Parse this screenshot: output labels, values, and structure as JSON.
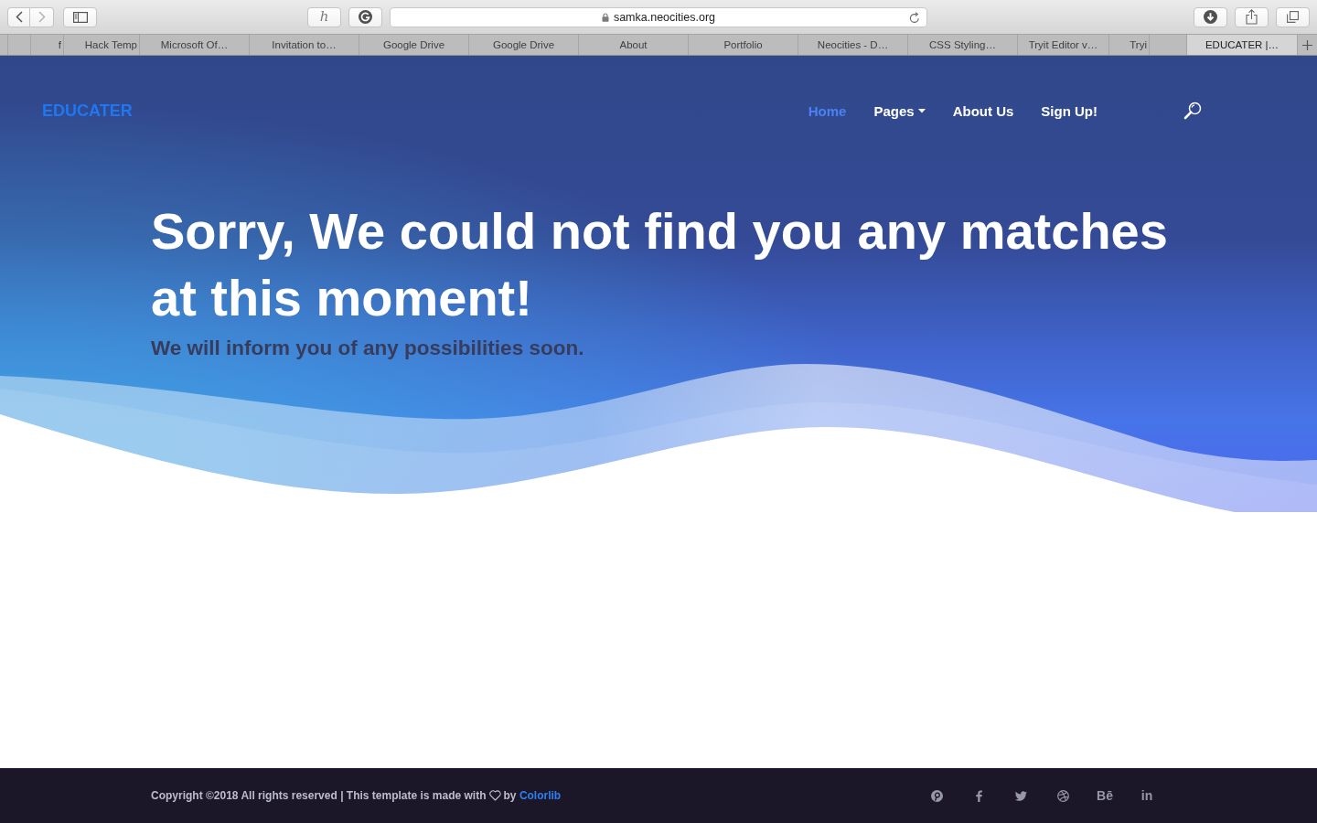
{
  "browser": {
    "nav_buttons": [
      {
        "kind": "back",
        "disabled": false
      },
      {
        "kind": "forward",
        "disabled": true
      }
    ],
    "extension_label": "h",
    "address": "samka.neocities.org",
    "tabs": [
      {
        "label": "f",
        "selected": false
      },
      {
        "label": "Hack Temp",
        "selected": false
      },
      {
        "label": "Microsoft Of…",
        "selected": false
      },
      {
        "label": "Invitation to…",
        "selected": false
      },
      {
        "label": "Google Drive",
        "selected": false
      },
      {
        "label": "Google Drive",
        "selected": false
      },
      {
        "label": "About",
        "selected": false
      },
      {
        "label": "Portfolio",
        "selected": false
      },
      {
        "label": "Neocities - D…",
        "selected": false
      },
      {
        "label": "CSS Styling…",
        "selected": false
      },
      {
        "label": "Tryit Editor v…",
        "selected": false
      },
      {
        "label": "Tryi",
        "selected": false
      },
      {
        "label": "EDUCATER |…",
        "selected": true
      }
    ]
  },
  "header": {
    "logo": "EDUCATER",
    "nav": [
      {
        "label": "Home",
        "selected": true,
        "dropdown": false
      },
      {
        "label": "Pages",
        "selected": false,
        "dropdown": true
      },
      {
        "label": "About Us",
        "selected": false,
        "dropdown": false
      },
      {
        "label": "Sign Up!",
        "selected": false,
        "dropdown": false
      }
    ]
  },
  "hero": {
    "title": "Sorry, We could not find you any matches at this moment!",
    "subtitle": "We will inform you of any possibilities soon."
  },
  "footer": {
    "copyright": "Copyright ©2018 All rights reserved | This template is made with",
    "credit_prefix": "by",
    "credit_link": "Colorlib",
    "social_glyphs": [
      "Bē",
      "in"
    ]
  }
}
